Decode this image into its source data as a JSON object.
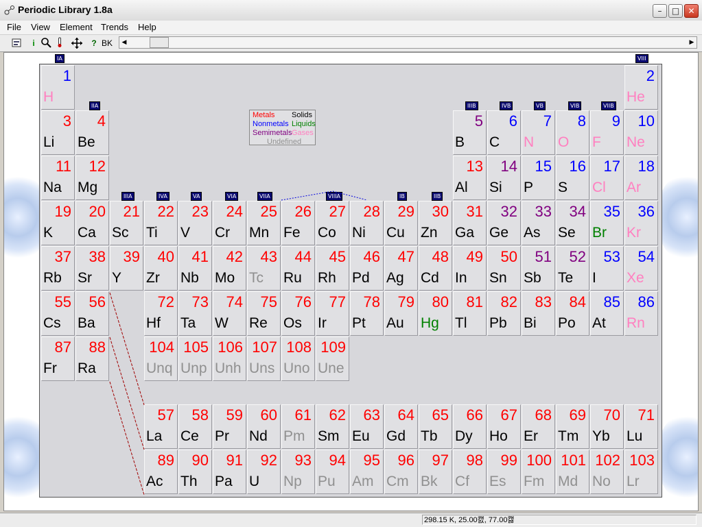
{
  "window": {
    "title": "Periodic Library 1.8a",
    "minimize": "–",
    "maximize": "□",
    "close": "✕"
  },
  "menu": [
    "File",
    "View",
    "Element",
    "Trends",
    "Help"
  ],
  "toolbar": {
    "info": "i",
    "help": "?",
    "bk": "BK"
  },
  "colors": {
    "metal": "#ff0000",
    "nonmetal": "#0000ff",
    "semimetal": "#800080",
    "solid": "#000000",
    "liquid": "#008000",
    "gas": "#ff80c0",
    "undefined": "#909090"
  },
  "legend": {
    "metals": "Metals",
    "solids": "Solids",
    "nonmetals": "Nonmetals",
    "liquids": "Liquids",
    "semimetals": "Semimetals",
    "gases": "Gases",
    "undefined": "Undefined"
  },
  "group_labels": [
    {
      "text": "IA",
      "pos": "top-1"
    },
    {
      "text": "VIII",
      "pos": "top-18"
    },
    {
      "text": "IIA",
      "pos": "2"
    },
    {
      "text": "IIIB",
      "pos": "13"
    },
    {
      "text": "IVB",
      "pos": "14"
    },
    {
      "text": "VB",
      "pos": "15"
    },
    {
      "text": "VIB",
      "pos": "16"
    },
    {
      "text": "VIIB",
      "pos": "17"
    },
    {
      "text": "IIIA",
      "pos": "3"
    },
    {
      "text": "IVA",
      "pos": "4"
    },
    {
      "text": "VA",
      "pos": "5"
    },
    {
      "text": "VIA",
      "pos": "6"
    },
    {
      "text": "VIIA",
      "pos": "7"
    },
    {
      "text": "VIIIA",
      "pos": "9"
    },
    {
      "text": "IB",
      "pos": "11"
    },
    {
      "text": "IIB",
      "pos": "12"
    }
  ],
  "elements": [
    [
      "1",
      "H",
      1,
      1,
      "n",
      "g"
    ],
    [
      "2",
      "He",
      18,
      1,
      "n",
      "g"
    ],
    [
      "3",
      "Li",
      1,
      2,
      "m",
      "s"
    ],
    [
      "4",
      "Be",
      2,
      2,
      "m",
      "s"
    ],
    [
      "5",
      "B",
      13,
      2,
      "sm",
      "s"
    ],
    [
      "6",
      "C",
      14,
      2,
      "n",
      "s"
    ],
    [
      "7",
      "N",
      15,
      2,
      "n",
      "g"
    ],
    [
      "8",
      "O",
      16,
      2,
      "n",
      "g"
    ],
    [
      "9",
      "F",
      17,
      2,
      "n",
      "g"
    ],
    [
      "10",
      "Ne",
      18,
      2,
      "n",
      "g"
    ],
    [
      "11",
      "Na",
      1,
      3,
      "m",
      "s"
    ],
    [
      "12",
      "Mg",
      2,
      3,
      "m",
      "s"
    ],
    [
      "13",
      "Al",
      13,
      3,
      "m",
      "s"
    ],
    [
      "14",
      "Si",
      14,
      3,
      "sm",
      "s"
    ],
    [
      "15",
      "P",
      15,
      3,
      "n",
      "s"
    ],
    [
      "16",
      "S",
      16,
      3,
      "n",
      "s"
    ],
    [
      "17",
      "Cl",
      17,
      3,
      "n",
      "g"
    ],
    [
      "18",
      "Ar",
      18,
      3,
      "n",
      "g"
    ],
    [
      "19",
      "K",
      1,
      4,
      "m",
      "s"
    ],
    [
      "20",
      "Ca",
      2,
      4,
      "m",
      "s"
    ],
    [
      "21",
      "Sc",
      3,
      4,
      "m",
      "s"
    ],
    [
      "22",
      "Ti",
      4,
      4,
      "m",
      "s"
    ],
    [
      "23",
      "V",
      5,
      4,
      "m",
      "s"
    ],
    [
      "24",
      "Cr",
      6,
      4,
      "m",
      "s"
    ],
    [
      "25",
      "Mn",
      7,
      4,
      "m",
      "s"
    ],
    [
      "26",
      "Fe",
      8,
      4,
      "m",
      "s"
    ],
    [
      "27",
      "Co",
      9,
      4,
      "m",
      "s"
    ],
    [
      "28",
      "Ni",
      10,
      4,
      "m",
      "s"
    ],
    [
      "29",
      "Cu",
      11,
      4,
      "m",
      "s"
    ],
    [
      "30",
      "Zn",
      12,
      4,
      "m",
      "s"
    ],
    [
      "31",
      "Ga",
      13,
      4,
      "m",
      "s"
    ],
    [
      "32",
      "Ge",
      14,
      4,
      "sm",
      "s"
    ],
    [
      "33",
      "As",
      15,
      4,
      "sm",
      "s"
    ],
    [
      "34",
      "Se",
      16,
      4,
      "sm",
      "s"
    ],
    [
      "35",
      "Br",
      17,
      4,
      "n",
      "l"
    ],
    [
      "36",
      "Kr",
      18,
      4,
      "n",
      "g"
    ],
    [
      "37",
      "Rb",
      1,
      5,
      "m",
      "s"
    ],
    [
      "38",
      "Sr",
      2,
      5,
      "m",
      "s"
    ],
    [
      "39",
      "Y",
      3,
      5,
      "m",
      "s"
    ],
    [
      "40",
      "Zr",
      4,
      5,
      "m",
      "s"
    ],
    [
      "41",
      "Nb",
      5,
      5,
      "m",
      "s"
    ],
    [
      "42",
      "Mo",
      6,
      5,
      "m",
      "s"
    ],
    [
      "43",
      "Tc",
      7,
      5,
      "m",
      "u"
    ],
    [
      "44",
      "Ru",
      8,
      5,
      "m",
      "s"
    ],
    [
      "45",
      "Rh",
      9,
      5,
      "m",
      "s"
    ],
    [
      "46",
      "Pd",
      10,
      5,
      "m",
      "s"
    ],
    [
      "47",
      "Ag",
      11,
      5,
      "m",
      "s"
    ],
    [
      "48",
      "Cd",
      12,
      5,
      "m",
      "s"
    ],
    [
      "49",
      "In",
      13,
      5,
      "m",
      "s"
    ],
    [
      "50",
      "Sn",
      14,
      5,
      "m",
      "s"
    ],
    [
      "51",
      "Sb",
      15,
      5,
      "sm",
      "s"
    ],
    [
      "52",
      "Te",
      16,
      5,
      "sm",
      "s"
    ],
    [
      "53",
      "I",
      17,
      5,
      "n",
      "s"
    ],
    [
      "54",
      "Xe",
      18,
      5,
      "n",
      "g"
    ],
    [
      "55",
      "Cs",
      1,
      6,
      "m",
      "s"
    ],
    [
      "56",
      "Ba",
      2,
      6,
      "m",
      "s"
    ],
    [
      "72",
      "Hf",
      4,
      6,
      "m",
      "s"
    ],
    [
      "73",
      "Ta",
      5,
      6,
      "m",
      "s"
    ],
    [
      "74",
      "W",
      6,
      6,
      "m",
      "s"
    ],
    [
      "75",
      "Re",
      7,
      6,
      "m",
      "s"
    ],
    [
      "76",
      "Os",
      8,
      6,
      "m",
      "s"
    ],
    [
      "77",
      "Ir",
      9,
      6,
      "m",
      "s"
    ],
    [
      "78",
      "Pt",
      10,
      6,
      "m",
      "s"
    ],
    [
      "79",
      "Au",
      11,
      6,
      "m",
      "s"
    ],
    [
      "80",
      "Hg",
      12,
      6,
      "m",
      "l"
    ],
    [
      "81",
      "Tl",
      13,
      6,
      "m",
      "s"
    ],
    [
      "82",
      "Pb",
      14,
      6,
      "m",
      "s"
    ],
    [
      "83",
      "Bi",
      15,
      6,
      "m",
      "s"
    ],
    [
      "84",
      "Po",
      16,
      6,
      "m",
      "s"
    ],
    [
      "85",
      "At",
      17,
      6,
      "n",
      "s"
    ],
    [
      "86",
      "Rn",
      18,
      6,
      "n",
      "g"
    ],
    [
      "87",
      "Fr",
      1,
      7,
      "m",
      "s"
    ],
    [
      "88",
      "Ra",
      2,
      7,
      "m",
      "s"
    ],
    [
      "104",
      "Unq",
      4,
      7,
      "m",
      "u"
    ],
    [
      "105",
      "Unp",
      5,
      7,
      "m",
      "u"
    ],
    [
      "106",
      "Unh",
      6,
      7,
      "m",
      "u"
    ],
    [
      "107",
      "Uns",
      7,
      7,
      "m",
      "u"
    ],
    [
      "108",
      "Uno",
      8,
      7,
      "m",
      "u"
    ],
    [
      "109",
      "Une",
      9,
      7,
      "m",
      "u"
    ],
    [
      "57",
      "La",
      4,
      9,
      "m",
      "s"
    ],
    [
      "58",
      "Ce",
      5,
      9,
      "m",
      "s"
    ],
    [
      "59",
      "Pr",
      6,
      9,
      "m",
      "s"
    ],
    [
      "60",
      "Nd",
      7,
      9,
      "m",
      "s"
    ],
    [
      "61",
      "Pm",
      8,
      9,
      "m",
      "u"
    ],
    [
      "62",
      "Sm",
      9,
      9,
      "m",
      "s"
    ],
    [
      "63",
      "Eu",
      10,
      9,
      "m",
      "s"
    ],
    [
      "64",
      "Gd",
      11,
      9,
      "m",
      "s"
    ],
    [
      "65",
      "Tb",
      12,
      9,
      "m",
      "s"
    ],
    [
      "66",
      "Dy",
      13,
      9,
      "m",
      "s"
    ],
    [
      "67",
      "Ho",
      14,
      9,
      "m",
      "s"
    ],
    [
      "68",
      "Er",
      15,
      9,
      "m",
      "s"
    ],
    [
      "69",
      "Tm",
      16,
      9,
      "m",
      "s"
    ],
    [
      "70",
      "Yb",
      17,
      9,
      "m",
      "s"
    ],
    [
      "71",
      "Lu",
      18,
      9,
      "m",
      "s"
    ],
    [
      "89",
      "Ac",
      4,
      10,
      "m",
      "s"
    ],
    [
      "90",
      "Th",
      5,
      10,
      "m",
      "s"
    ],
    [
      "91",
      "Pa",
      6,
      10,
      "m",
      "s"
    ],
    [
      "92",
      "U",
      7,
      10,
      "m",
      "s"
    ],
    [
      "93",
      "Np",
      8,
      10,
      "m",
      "u"
    ],
    [
      "94",
      "Pu",
      9,
      10,
      "m",
      "u"
    ],
    [
      "95",
      "Am",
      10,
      10,
      "m",
      "u"
    ],
    [
      "96",
      "Cm",
      11,
      10,
      "m",
      "u"
    ],
    [
      "97",
      "Bk",
      12,
      10,
      "m",
      "u"
    ],
    [
      "98",
      "Cf",
      13,
      10,
      "m",
      "u"
    ],
    [
      "99",
      "Es",
      14,
      10,
      "m",
      "u"
    ],
    [
      "100",
      "Fm",
      15,
      10,
      "m",
      "u"
    ],
    [
      "101",
      "Md",
      16,
      10,
      "m",
      "u"
    ],
    [
      "102",
      "No",
      17,
      10,
      "m",
      "u"
    ],
    [
      "103",
      "Lr",
      18,
      10,
      "m",
      "u"
    ]
  ],
  "status": {
    "conditions": "298.15 K, 25.00캜, 77.00캟"
  }
}
